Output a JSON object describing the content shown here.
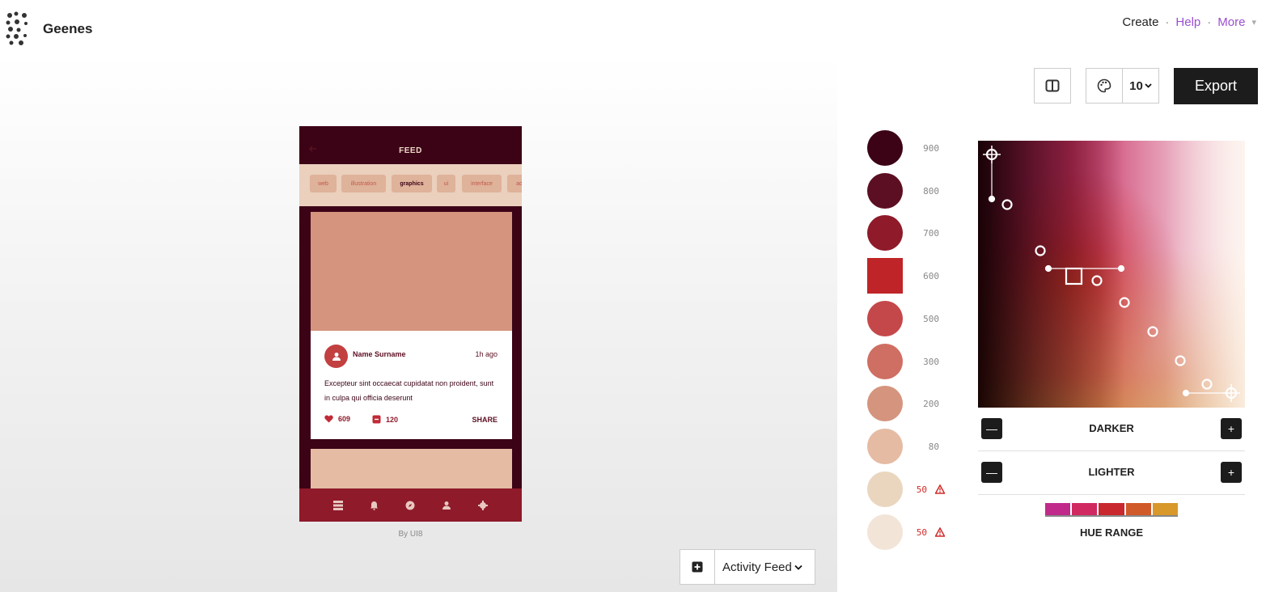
{
  "app": {
    "name": "Geenes",
    "logo_icon": "dots-logo-icon"
  },
  "topnav": {
    "create": "Create",
    "sep": "·",
    "help": "Help",
    "more": "More",
    "more_caret": "▾"
  },
  "toolbar": {
    "layout_icon": "split-view-icon",
    "palette_icon": "palette-icon",
    "palette_count": "10",
    "export_label": "Export"
  },
  "phone": {
    "header_title": "FEED",
    "back_icon": "arrow-left-icon",
    "tags": [
      {
        "label": "web",
        "active": false
      },
      {
        "label": "illustration",
        "active": false
      },
      {
        "label": "graphics",
        "active": true
      },
      {
        "label": "ui",
        "active": false
      },
      {
        "label": "interface",
        "active": false
      },
      {
        "label": "ad",
        "active": false
      }
    ],
    "card": {
      "name": "Name Surname",
      "time": "1h ago",
      "text": "Excepteur sint occaecat cupidatat non proident, sunt in culpa qui officia deserunt",
      "likes": "609",
      "comments": "120",
      "share": "SHARE"
    },
    "nav_icons": [
      "list-icon",
      "bell-icon",
      "compass-icon",
      "user-icon",
      "settings-icon"
    ],
    "credit": "By UI8"
  },
  "template": {
    "add_icon": "plus-square-icon",
    "selected": "Activity Feed",
    "caret": "⌄"
  },
  "palette": [
    {
      "label": "900",
      "color": "#3c0316",
      "warn": false,
      "shape": "circle"
    },
    {
      "label": "800",
      "color": "#5c0f22",
      "warn": false,
      "shape": "circle"
    },
    {
      "label": "700",
      "color": "#8e1a2a",
      "warn": false,
      "shape": "circle"
    },
    {
      "label": "600",
      "color": "#bf2528",
      "warn": false,
      "shape": "square"
    },
    {
      "label": "500",
      "color": "#c4484a",
      "warn": false,
      "shape": "circle"
    },
    {
      "label": "300",
      "color": "#cf6e62",
      "warn": false,
      "shape": "circle"
    },
    {
      "label": "200",
      "color": "#d5947e",
      "warn": false,
      "shape": "circle"
    },
    {
      "label": "80",
      "color": "#e5bba3",
      "warn": false,
      "shape": "circle"
    },
    {
      "label": "50",
      "color": "#ead6bf",
      "warn": true,
      "shape": "circle"
    },
    {
      "label": "50",
      "color": "#f2e5d8",
      "warn": true,
      "shape": "circle"
    }
  ],
  "picker": {
    "darker": "DARKER",
    "lighter": "LIGHTER",
    "minus": "—",
    "plus": "+",
    "hue_range": "HUE RANGE",
    "hue_colors": [
      "#c02a8a",
      "#d02860",
      "#c8282e",
      "#d05a2a",
      "#d8982a"
    ]
  }
}
